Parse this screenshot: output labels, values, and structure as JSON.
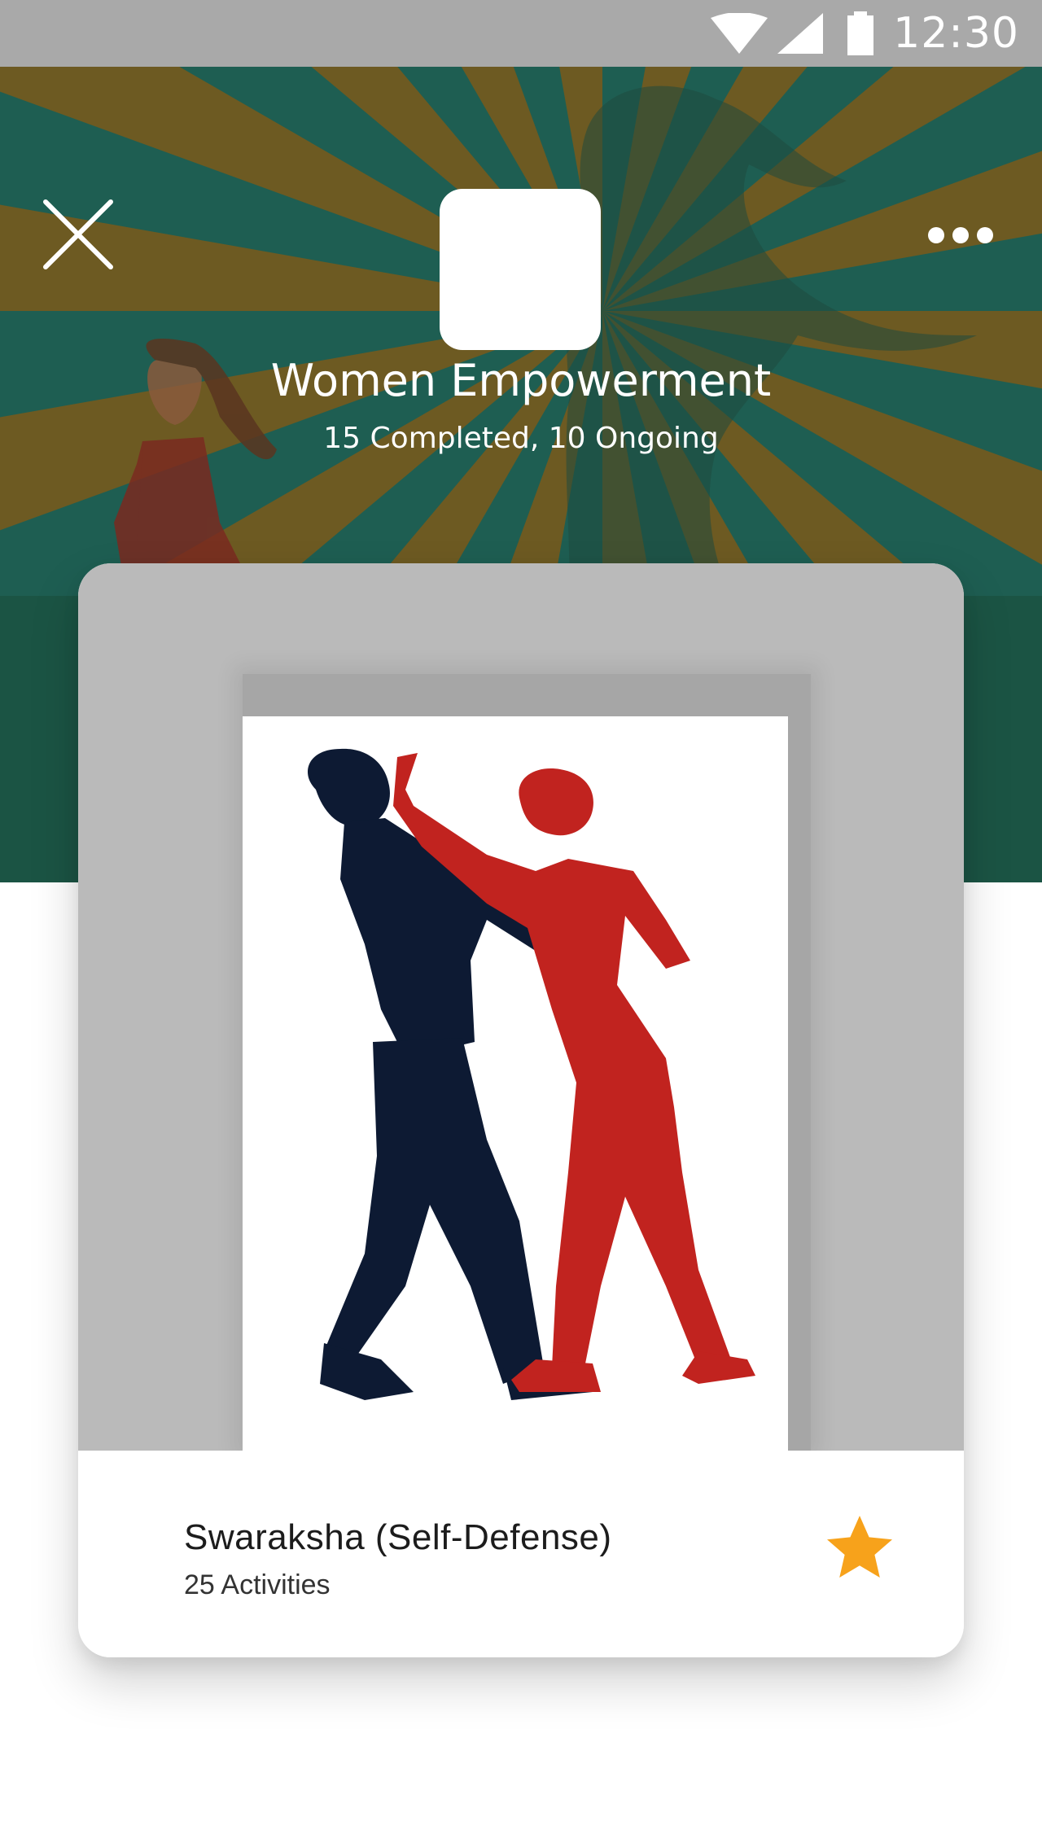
{
  "status_bar": {
    "time": "12:30",
    "icons": [
      "wifi-icon",
      "cellular-signal-icon",
      "battery-icon"
    ]
  },
  "header": {
    "close_icon": "close-icon",
    "more_icon": "more-horizontal-icon",
    "title": "Women Empowerment",
    "subtitle": "15 Completed, 10 Ongoing",
    "colors": {
      "ray_gold": "#6d5a22",
      "ray_teal": "#1e5e52",
      "lower_band": "#1b5444"
    }
  },
  "card": {
    "title": "Swaraksha (Self-Defense)",
    "activities": "25 Activities",
    "favorite_icon": "star-icon",
    "star_color": "#f7a21b"
  }
}
